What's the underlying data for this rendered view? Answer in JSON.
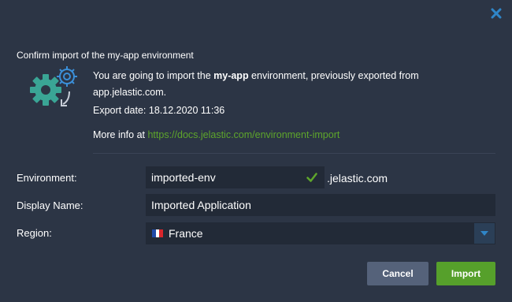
{
  "dialog": {
    "confirm_title": "Confirm import of the my-app environment",
    "message_before": "You are going to import the ",
    "message_env": "my-app",
    "message_after": " environment, previously exported from app.jelastic.com.",
    "export_date": "Export date: 18.12.2020 11:36",
    "more_info_label": "More info at ",
    "more_info_link": "https://docs.jelastic.com/environment-import"
  },
  "form": {
    "environment_label": "Environment:",
    "environment_value": "imported-env",
    "environment_suffix": ".jelastic.com",
    "display_name_label": "Display Name:",
    "display_name_value": "Imported Application",
    "region_label": "Region:",
    "region_value": "France"
  },
  "buttons": {
    "cancel": "Cancel",
    "import": "Import"
  },
  "colors": {
    "background": "#2c3545",
    "accent_green": "#56a02b",
    "link_green": "#5ea62b",
    "gear_teal": "#3aa595",
    "gear_blue": "#3b8fd8",
    "close_blue": "#2f86c8"
  },
  "icons": {
    "close": "close-icon",
    "gear": "gears-import-icon",
    "check": "check-icon",
    "flag": "france-flag-icon",
    "dropdown": "chevron-down-icon"
  }
}
